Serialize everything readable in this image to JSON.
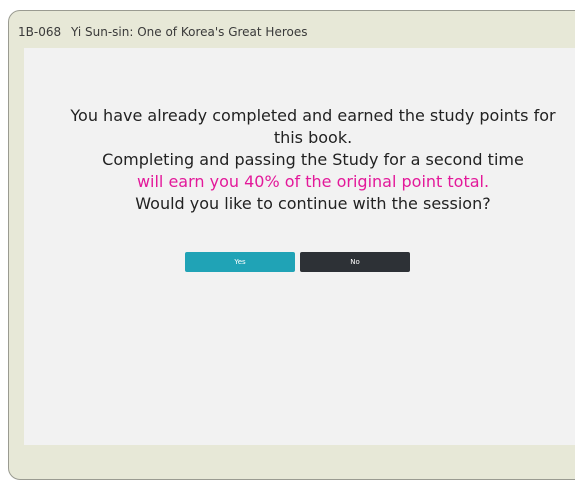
{
  "header": {
    "book_code": "1B-068",
    "book_title": "Yi Sun-sin: One of Korea's Great Heroes"
  },
  "dialog": {
    "line1": "You have already completed and earned the study points for",
    "line2": "this book.",
    "line3": "Completing and passing the Study for a second time",
    "line4_highlight": "will earn you 40% of the original point total.",
    "line5": "Would you like to continue with the session?",
    "yes_label": "Yes",
    "no_label": "No"
  },
  "colors": {
    "frame_bg": "#e7e8d7",
    "panel_bg": "#f2f2f2",
    "highlight": "#e3199a",
    "yes_button": "#20a3b6",
    "no_button": "#2d3136"
  }
}
